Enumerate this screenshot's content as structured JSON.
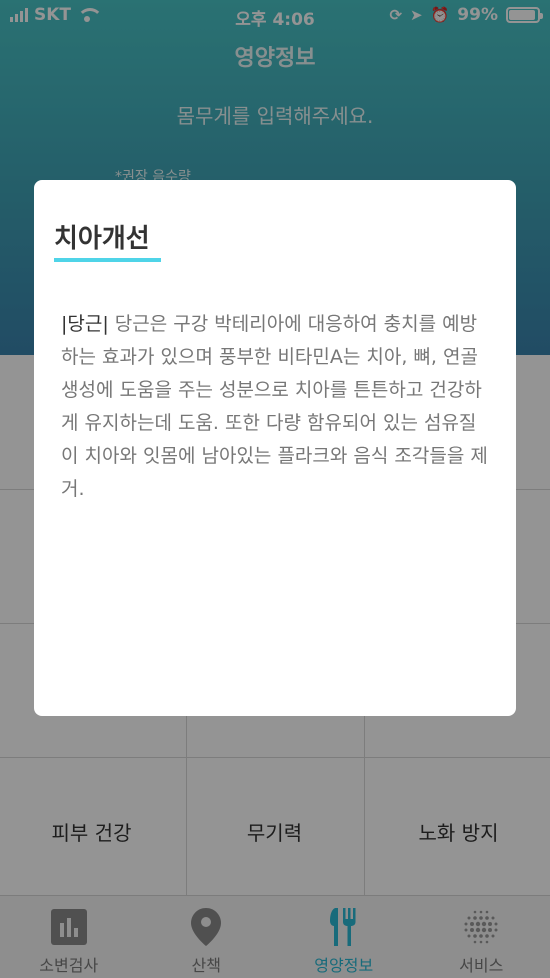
{
  "status_bar": {
    "carrier": "SKT",
    "time": "오후 4:06",
    "battery": "99%"
  },
  "header": {
    "title": "영양정보",
    "subtitle": "몸무게를 입력해주세요.",
    "note": "*권장 음수량"
  },
  "grid": {
    "bottom_row": [
      "피부 건강",
      "무기력",
      "노화 방지"
    ]
  },
  "modal": {
    "title": "치아개선",
    "keyword": "|당근|",
    "text": " 당근은 구강 박테리아에 대응하여 충치를 예방하는 효과가 있으며 풍부한 비타민A는 치아, 뼈, 연골 생성에 도움을 주는 성분으로 치아를 튼튼하고 건강하게 유지하는데 도움. 또한 다량 함유되어 있는 섬유질이 치아와 잇몸에 남아있는 플라크와 음식 조각들을 제거."
  },
  "tabs": [
    {
      "label": "소변검사",
      "icon": "bar-chart-icon"
    },
    {
      "label": "산책",
      "icon": "location-pin-icon"
    },
    {
      "label": "영양정보",
      "icon": "fork-knife-icon"
    },
    {
      "label": "서비스",
      "icon": "dots-sphere-icon"
    }
  ],
  "colors": {
    "accent": "#2ab9d4",
    "title_underline": "#4fd4e8",
    "hero_top": "#49c4c6",
    "hero_bottom": "#3a83ad"
  }
}
